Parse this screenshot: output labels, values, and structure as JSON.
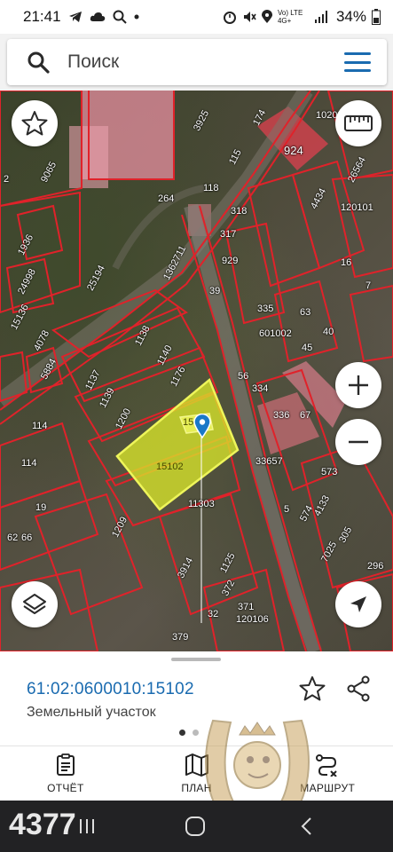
{
  "status_bar": {
    "time": "21:41",
    "network": "Vo) LTE 4G+",
    "battery": "34%"
  },
  "search": {
    "placeholder": "Поиск"
  },
  "map": {
    "selected_parcel": "15102",
    "selected_parcel_top": "15102",
    "parcel_labels": [
      "924",
      "1020",
      "3925",
      "174",
      "115",
      "118",
      "264",
      "318",
      "317",
      "929",
      "1362711",
      "25194",
      "39",
      "335",
      "63",
      "601002",
      "45",
      "40",
      "1138",
      "1140",
      "1176",
      "1137",
      "1139",
      "1200",
      "114",
      "114",
      "336",
      "67",
      "33657",
      "573",
      "11303",
      "1125",
      "3914",
      "372",
      "371",
      "120106",
      "379",
      "56",
      "334",
      "120101",
      "26564",
      "4434",
      "16",
      "7",
      "1936",
      "24998",
      "15136",
      "4078",
      "5884",
      "9065",
      "2",
      "19",
      "1209",
      "7025",
      "305",
      "296",
      "4133",
      "574",
      "32",
      "62",
      "66",
      "5"
    ],
    "colors": {
      "parcel_stroke": "#e0222a",
      "selected_fill": "#d9e62a",
      "selected_stroke": "#e8f04a"
    }
  },
  "map_buttons": {
    "favorite": "star-icon",
    "ruler": "ruler-icon",
    "zoom_in": "+",
    "zoom_out": "−",
    "layers": "layers-icon",
    "locate": "navigation-icon"
  },
  "sheet": {
    "cadastral_number": "61:02:0600010:15102",
    "object_type": "Земельный участок",
    "accent": "#1a6bb0"
  },
  "nav": {
    "report": "ОТЧЁТ",
    "plan": "ПЛАН",
    "route": "МАРШРУТ"
  },
  "overlay": {
    "number": "4377"
  }
}
